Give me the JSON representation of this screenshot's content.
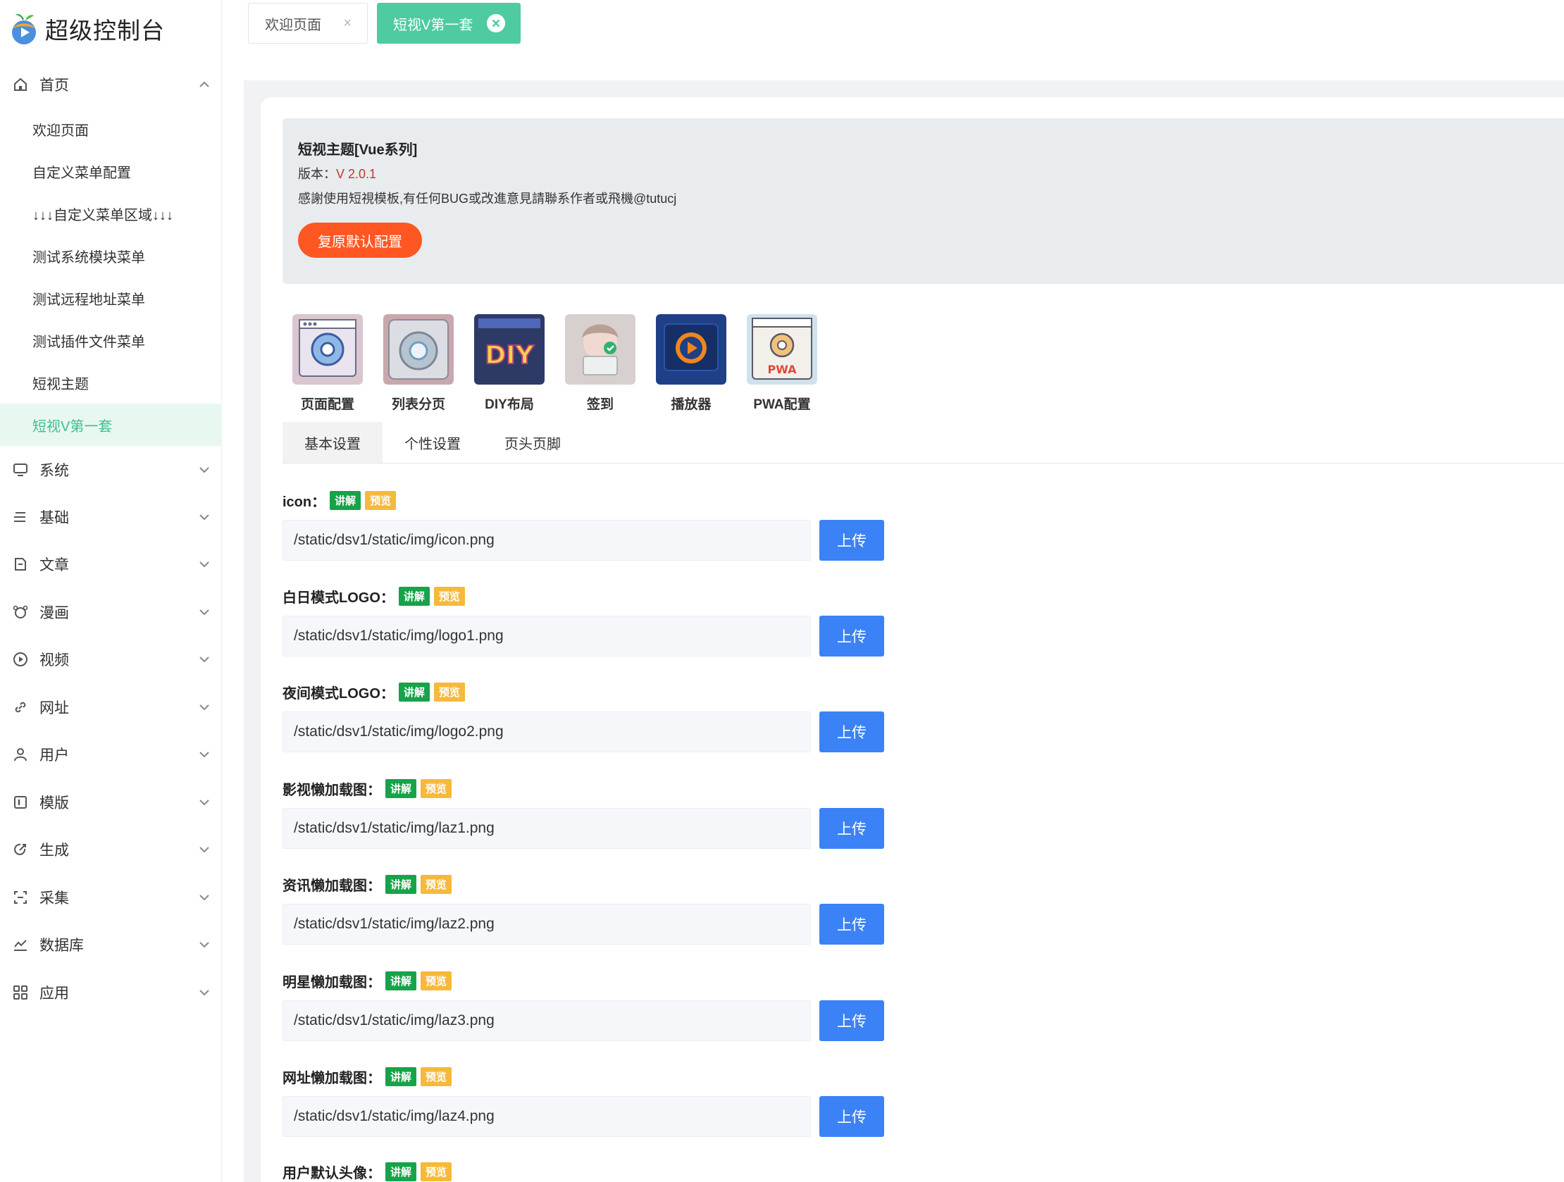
{
  "app": {
    "title": "超级控制台"
  },
  "tabs": [
    {
      "label": "欢迎页面",
      "close": "×"
    },
    {
      "label": "短视V第一套"
    }
  ],
  "sidebar": {
    "home": {
      "label": "首页"
    },
    "sub_items": [
      {
        "label": "欢迎页面"
      },
      {
        "label": "自定义菜单配置"
      },
      {
        "label": "↓↓↓自定义菜单区域↓↓↓"
      },
      {
        "label": "测试系统模块菜单"
      },
      {
        "label": "测试远程地址菜单"
      },
      {
        "label": "测试插件文件菜单"
      },
      {
        "label": "短视主题"
      },
      {
        "label": "短视V第一套"
      }
    ],
    "groups": [
      {
        "label": "系统",
        "icon": "monitor-icon"
      },
      {
        "label": "基础",
        "icon": "list-icon"
      },
      {
        "label": "文章",
        "icon": "document-icon"
      },
      {
        "label": "漫画",
        "icon": "bear-icon"
      },
      {
        "label": "视频",
        "icon": "play-circle-icon"
      },
      {
        "label": "网址",
        "icon": "link-icon"
      },
      {
        "label": "用户",
        "icon": "user-icon"
      },
      {
        "label": "模版",
        "icon": "template-icon"
      },
      {
        "label": "生成",
        "icon": "generate-icon"
      },
      {
        "label": "采集",
        "icon": "scan-icon"
      },
      {
        "label": "数据库",
        "icon": "chart-line-icon"
      },
      {
        "label": "应用",
        "icon": "apps-grid-icon"
      }
    ]
  },
  "notice": {
    "title": "短视主题[Vue系列]",
    "version_label": "版本：",
    "version": "V 2.0.1",
    "desc": "感謝使用短視模板,有任何BUG或改進意見請聯系作者或飛機@tutucj",
    "reset_button": "复原默认配置"
  },
  "tools": [
    {
      "label": "页面配置",
      "icon": "page-config-icon"
    },
    {
      "label": "列表分页",
      "icon": "list-page-icon"
    },
    {
      "label": "DIY布局",
      "icon": "diy-layout-icon"
    },
    {
      "label": "签到",
      "icon": "sign-in-icon"
    },
    {
      "label": "播放器",
      "icon": "player-icon"
    },
    {
      "label": "PWA配置",
      "icon": "pwa-config-icon"
    }
  ],
  "subtabs": [
    {
      "label": "基本设置"
    },
    {
      "label": "个性设置"
    },
    {
      "label": "页头页脚"
    }
  ],
  "badges": {
    "explain": "讲解",
    "preview": "预览"
  },
  "upload_label": "上传",
  "fields": [
    {
      "label": "icon：",
      "value": "/static/dsv1/static/img/icon.png"
    },
    {
      "label": "白日模式LOGO：",
      "value": "/static/dsv1/static/img/logo1.png"
    },
    {
      "label": "夜间模式LOGO：",
      "value": "/static/dsv1/static/img/logo2.png"
    },
    {
      "label": "影视懒加载图：",
      "value": "/static/dsv1/static/img/laz1.png"
    },
    {
      "label": "资讯懒加载图：",
      "value": "/static/dsv1/static/img/laz2.png"
    },
    {
      "label": "明星懒加载图：",
      "value": "/static/dsv1/static/img/laz3.png"
    },
    {
      "label": "网址懒加载图：",
      "value": "/static/dsv1/static/img/laz4.png"
    },
    {
      "label": "用户默认头像：",
      "value": ""
    }
  ],
  "colors": {
    "accent": "#4ecba0",
    "reset": "#ff5722",
    "upload": "#3b82f6",
    "badge_green": "#16a34a",
    "badge_yellow": "#f6b93b"
  }
}
